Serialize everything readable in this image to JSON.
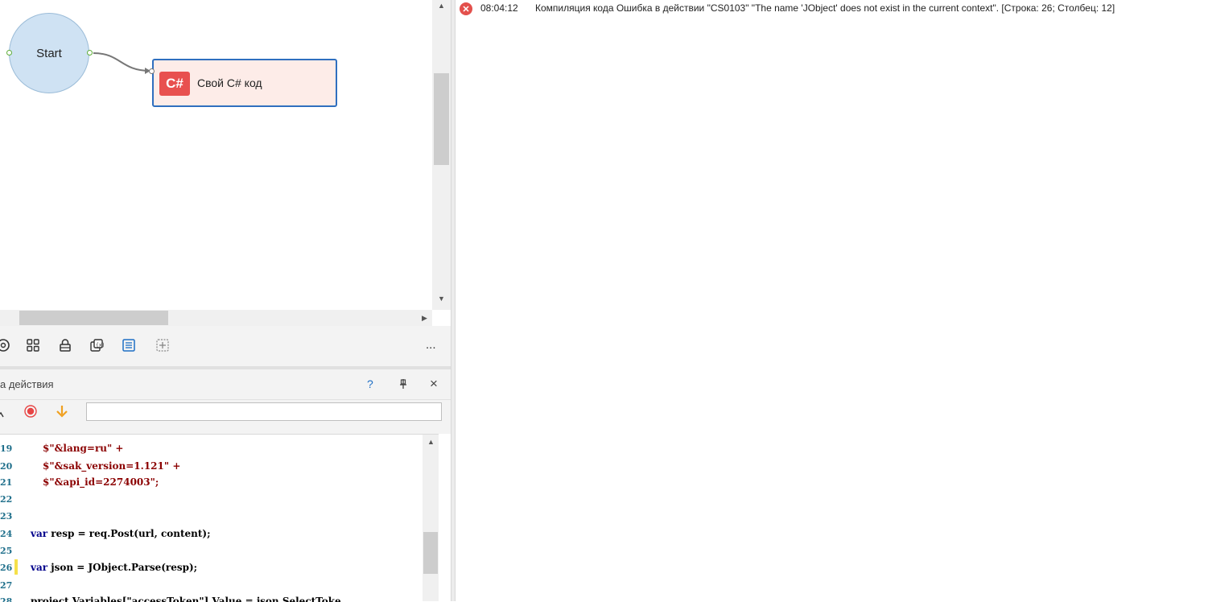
{
  "canvas": {
    "start_label": "Start",
    "action_node": {
      "badge": "C#",
      "label": "Свой C# код"
    }
  },
  "toolbar": {
    "icons": [
      "settings-icon",
      "grid-icon",
      "lock-icon",
      "variables-icon",
      "list-icon",
      "add-block-icon"
    ],
    "more_label": "..."
  },
  "panel": {
    "title": "а действия",
    "help_label": "?",
    "pin_label": "⊥",
    "close_label": "×",
    "search_value": ""
  },
  "editor": {
    "lines": [
      {
        "num": "19",
        "text": "$\"&lang=ru\" +"
      },
      {
        "num": "20",
        "text": "$\"&sak_version=1.121\" +"
      },
      {
        "num": "21",
        "text": "$\"&api_id=2274003\";"
      },
      {
        "num": "22",
        "text": ""
      },
      {
        "num": "23",
        "text": ""
      },
      {
        "num": "24",
        "kw": "var",
        "text": " resp = req.Post(url, content);"
      },
      {
        "num": "25",
        "text": ""
      },
      {
        "num": "26",
        "kw": "var",
        "text": " json = JObject.Parse(resp);"
      },
      {
        "num": "27",
        "text": ""
      },
      {
        "num": "28",
        "text": "project.Variables[\"accessToken\"].Value = json.SelectToke"
      }
    ]
  },
  "log": {
    "time": "08:04:12",
    "message": "Компиляция кода  Ошибка в действии \"CS0103\" \"The name 'JObject' does not exist in the current context\". [Строка: 26; Столбец: 12]"
  }
}
